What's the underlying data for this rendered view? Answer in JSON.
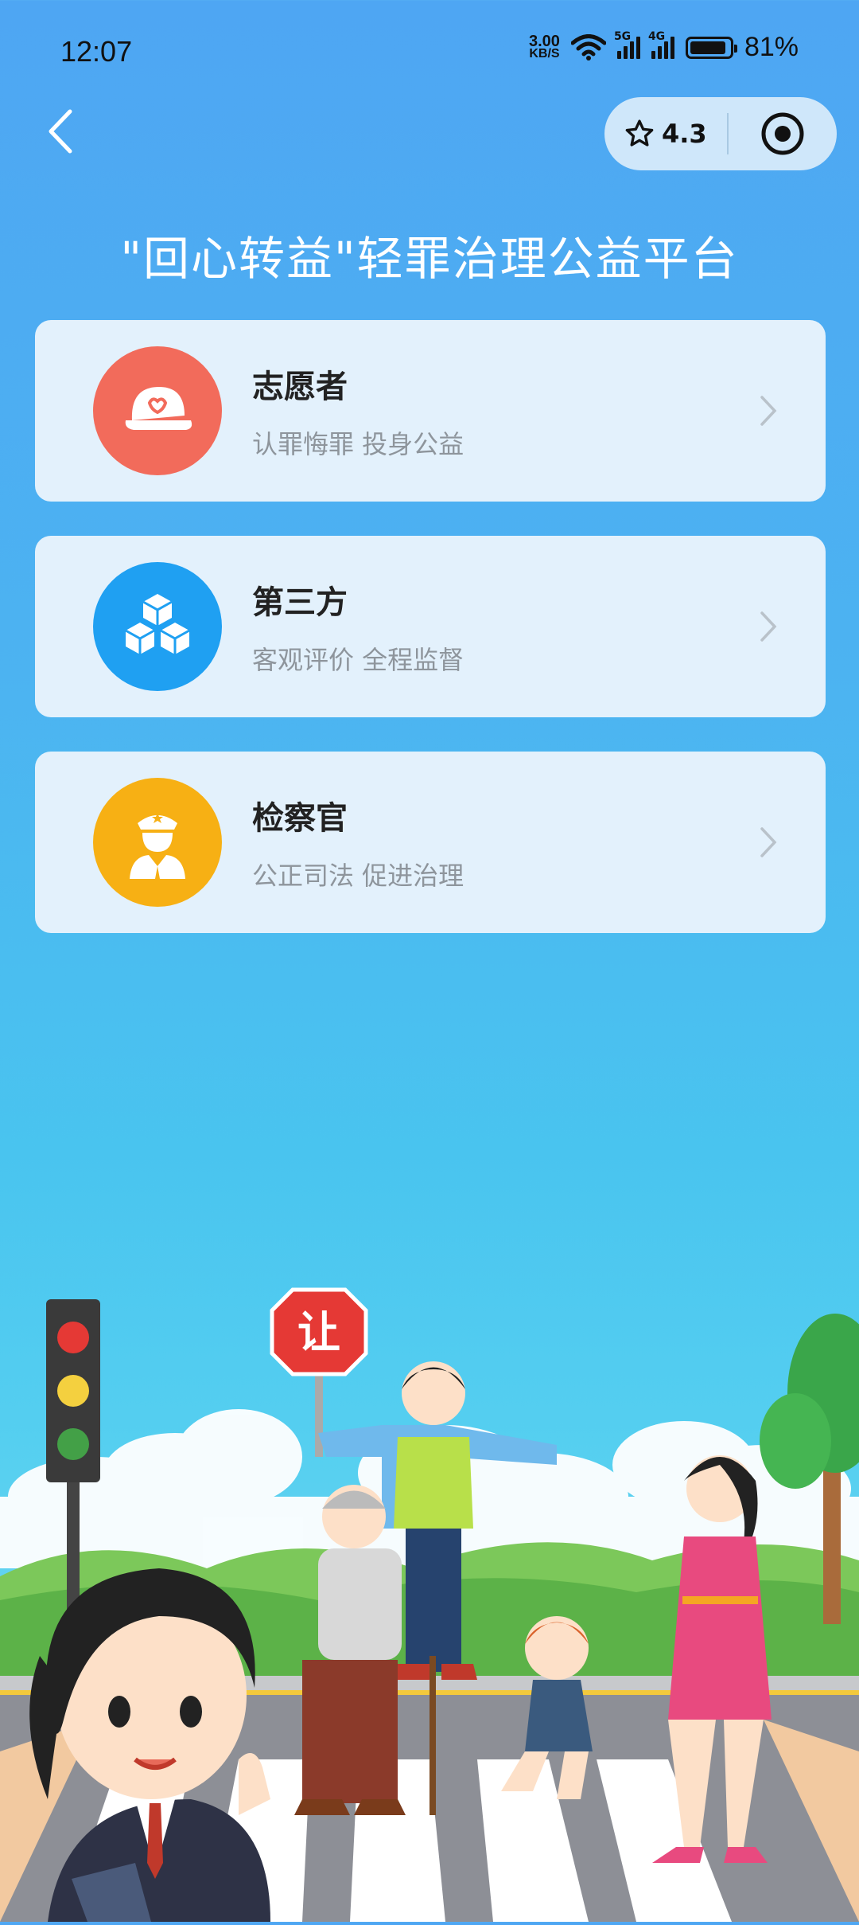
{
  "status": {
    "time": "12:07",
    "speed_value": "3.00",
    "speed_unit": "KB/S",
    "net1": "5G",
    "net2": "4G",
    "battery": "81%",
    "battery_level": 0.81
  },
  "header": {
    "rating": "4.3"
  },
  "page": {
    "title": "\"回心转益\"轻罪治理公益平台"
  },
  "cards": [
    {
      "name": "志愿者",
      "desc": "认罪悔罪 投身公益",
      "icon": "cap-icon",
      "color": "#f26b5b"
    },
    {
      "name": "第三方",
      "desc": "客观评价 全程监督",
      "icon": "cubes-icon",
      "color": "#1fa0f2"
    },
    {
      "name": "检察官",
      "desc": "公正司法 促进治理",
      "icon": "prosecutor-icon",
      "color": "#f7b014"
    }
  ],
  "illustration": {
    "sign_text": "让"
  }
}
